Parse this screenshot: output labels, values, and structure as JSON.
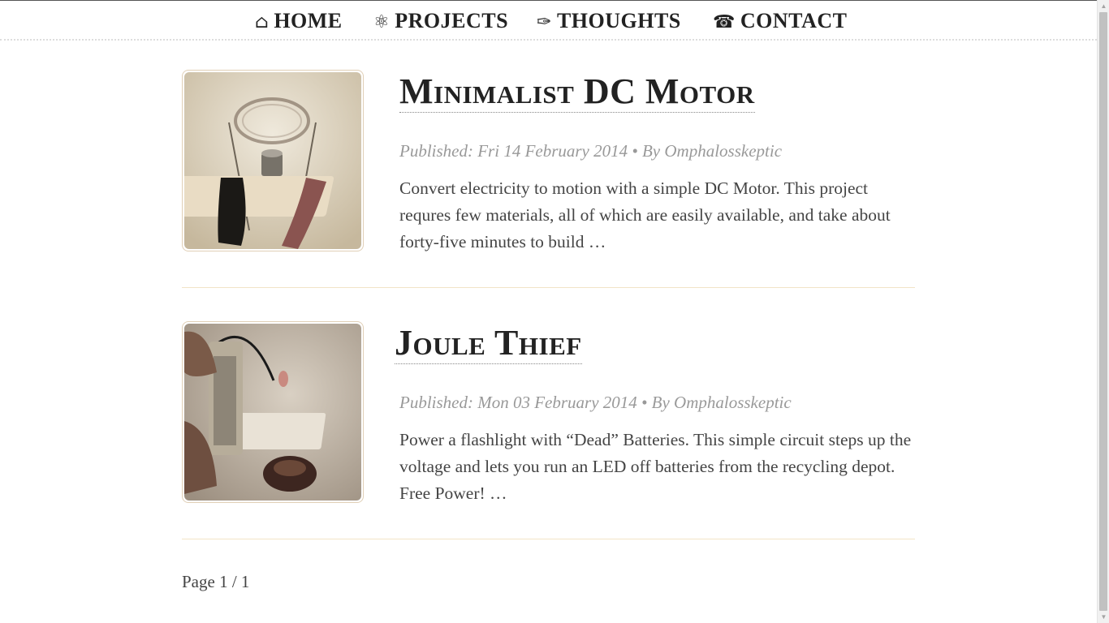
{
  "nav": {
    "items": [
      {
        "icon": "⌂",
        "label": "HOME"
      },
      {
        "icon": "⚛",
        "label": "PROJECTS"
      },
      {
        "icon": "✑",
        "label": "THOUGHTS"
      },
      {
        "icon": "☎",
        "label": "CONTACT"
      }
    ]
  },
  "posts": [
    {
      "title": "Minimalist DC Motor",
      "meta": "Published: Fri 14 February 2014 • By Omphalosskeptic",
      "excerpt": "Convert electricity to motion with a simple DC Motor. This project requres few materials, all of which are easily available, and take about forty-five minutes to build …",
      "thumbnail_icon": "dc-motor-photo"
    },
    {
      "title": "Joule Thief",
      "meta": "Published: Mon 03 February 2014 • By Omphalosskeptic",
      "excerpt": "Power a flashlight with “Dead” Batteries. This simple circuit steps up the voltage and lets you run an LED off batteries from the recycling depot. Free Power! …",
      "thumbnail_icon": "joule-thief-photo"
    }
  ],
  "pager": {
    "text": "Page 1 / 1"
  },
  "colors": {
    "accent_border": "#e0cfb6",
    "separator": "#f2e4c7",
    "meta": "#999999"
  }
}
